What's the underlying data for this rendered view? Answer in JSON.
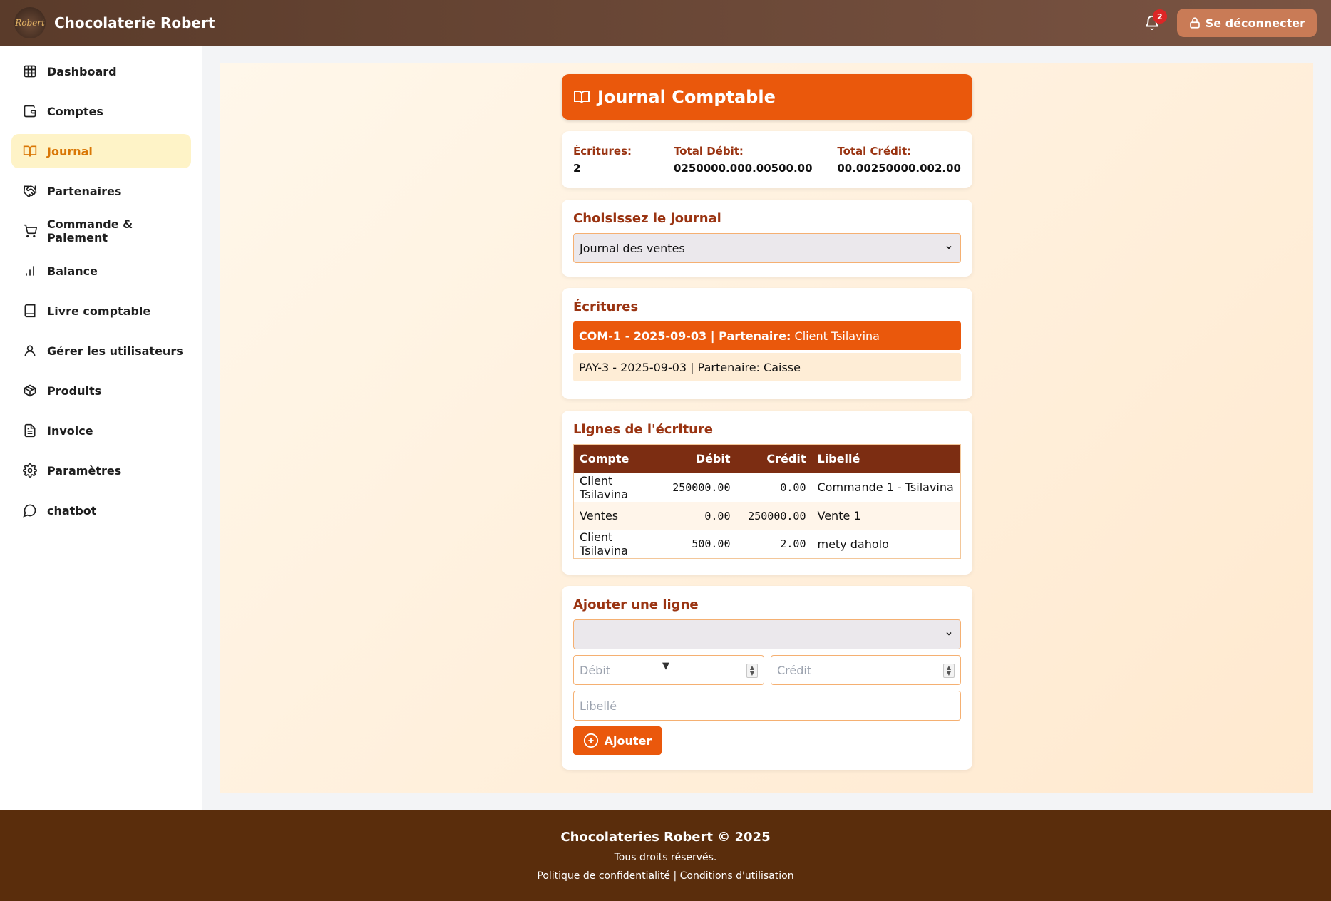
{
  "header": {
    "logo_text": "Robert",
    "app_title": "Chocolaterie Robert",
    "notification_count": "2",
    "logout_label": "Se déconnecter"
  },
  "sidebar": {
    "items": [
      {
        "label": "Dashboard",
        "icon": "grid-icon"
      },
      {
        "label": "Comptes",
        "icon": "wallet-icon"
      },
      {
        "label": "Journal",
        "icon": "book-open-icon",
        "active": true
      },
      {
        "label": "Partenaires",
        "icon": "handshake-icon"
      },
      {
        "label": "Commande & Paiement",
        "icon": "cart-icon"
      },
      {
        "label": "Balance",
        "icon": "bar-chart-icon"
      },
      {
        "label": "Livre comptable",
        "icon": "book-icon"
      },
      {
        "label": "Gérer les utilisateurs",
        "icon": "user-icon"
      },
      {
        "label": "Produits",
        "icon": "package-icon"
      },
      {
        "label": "Invoice",
        "icon": "file-icon"
      },
      {
        "label": "Paramètres",
        "icon": "gear-icon"
      },
      {
        "label": "chatbot",
        "icon": "chat-icon"
      }
    ]
  },
  "page": {
    "title": "Journal Comptable"
  },
  "summary": {
    "entries_label": "Écritures:",
    "entries_value": "2",
    "debit_label": "Total Débit:",
    "debit_value": "0250000.000.00500.00",
    "credit_label": "Total Crédit:",
    "credit_value": "00.00250000.002.00"
  },
  "journal_select": {
    "title": "Choisissez le journal",
    "selected": "Journal des ventes"
  },
  "entries": {
    "title": "Écritures",
    "items": [
      {
        "ref": "COM-1 - 2025-09-03 | Partenaire:",
        "partner": "Client Tsilavina"
      },
      {
        "ref": "PAY-3 - 2025-09-03 | Partenaire:",
        "partner": "Caisse"
      }
    ]
  },
  "lines": {
    "title": "Lignes de l'écriture",
    "columns": [
      "Compte",
      "Débit",
      "Crédit",
      "Libellé"
    ],
    "rows": [
      {
        "compte": "Client Tsilavina",
        "debit": "250000.00",
        "credit": "0.00",
        "libelle": "Commande 1 - Tsilavina"
      },
      {
        "compte": "Ventes",
        "debit": "0.00",
        "credit": "250000.00",
        "libelle": "Vente 1"
      },
      {
        "compte": "Client Tsilavina",
        "debit": "500.00",
        "credit": "2.00",
        "libelle": "mety daholo"
      }
    ]
  },
  "add_line": {
    "title": "Ajouter une ligne",
    "account_selected": "",
    "debit_placeholder": "Débit",
    "credit_placeholder": "Crédit",
    "label_placeholder": "Libellé",
    "submit_label": "Ajouter"
  },
  "footer": {
    "brand": "Chocolateries Robert © 2025",
    "rights": "Tous droits réservés.",
    "privacy_link": "Politique de confidentialité",
    "separator": "|",
    "terms_link": "Conditions d'utilisation"
  },
  "colors": {
    "accent": "#ea580c",
    "header_bg": "#5a3b2a",
    "footer_bg": "#5a2d0c",
    "table_header": "#7c2d12",
    "title_text": "#9a3412"
  }
}
